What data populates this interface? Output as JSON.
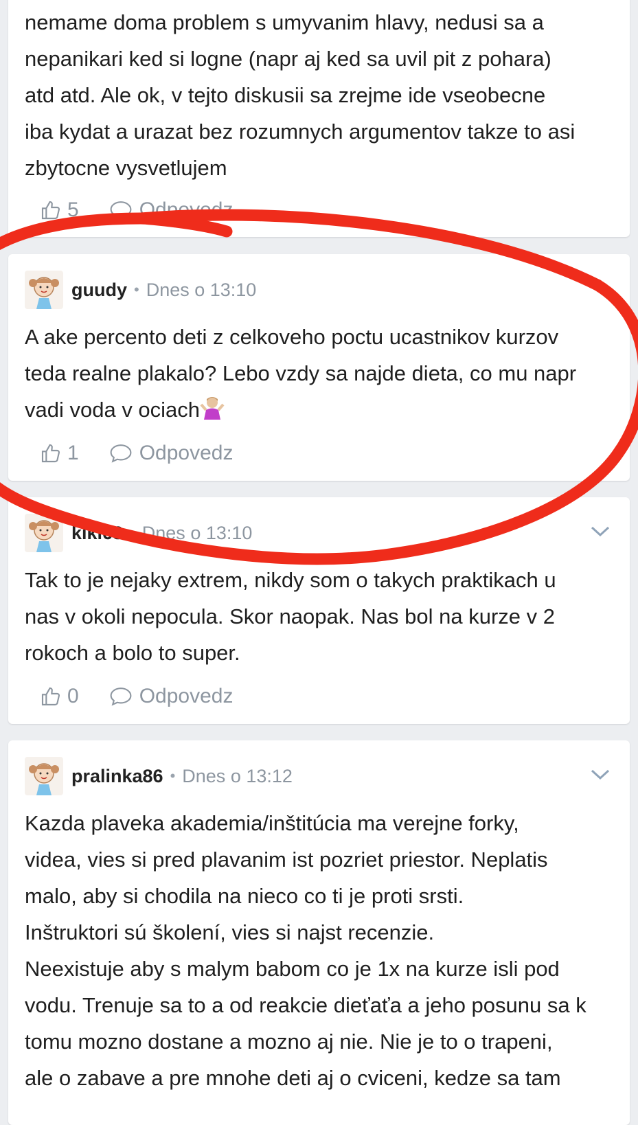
{
  "comments": [
    {
      "body": "nemame doma problem s umyvanim hlavy, nedusi sa a\nnepanikari ked si logne (napr aj ked sa uvil pit z pohara)\natd atd. Ale ok, v tejto diskusii sa zrejme ide vseobecne\niba kydat a urazat bez rozumnych argumentov takze to asi\nzbytocne vysvetlujem",
      "likes": "5",
      "reply_label": "Odpovedz"
    },
    {
      "username": "guudy",
      "time": "Dnes o 13:10",
      "body": "A ake percento deti z celkoveho poctu ucastnikov kurzov\nteda realne plakalo? Lebo vzdy sa najde dieta, co mu napr\nvadi voda v ociach",
      "emoji": "person-shrugging",
      "likes": "1",
      "reply_label": "Odpovedz"
    },
    {
      "username": "kiki68",
      "time": "Dnes o 13:10",
      "body": "Tak to je nejaky extrem, nikdy som o takych praktikach u\nnas v okoli nepocula. Skor naopak. Nas bol na kurze v 2\nrokoch a bolo to super.",
      "likes": "0",
      "reply_label": "Odpovedz"
    },
    {
      "username": "pralinka86",
      "time": "Dnes o 13:12",
      "body": "Kazda plaveka akademia/inštitúcia ma verejne forky,\nvidea, vies si pred plavanim ist pozriet priestor. Neplatis\nmalo, aby si chodila na nieco co ti je proti srsti.\nInštruktori sú školení, vies si najst recenzie.\nNeexistuje aby s malym babom co je 1x na kurze isli pod\nvodu. Trenuje sa to a od reakcie dieťaťa a jeho posunu sa k\ntomu mozno dostane a mozno aj nie. Nie je to o trapeni,\nale o zabave a pre mnohe deti aj o cviceni, kedze sa tam"
    }
  ],
  "colors": {
    "annotation": "#ef2c1b",
    "meta": "#8d96a0",
    "background": "#eceef1"
  }
}
